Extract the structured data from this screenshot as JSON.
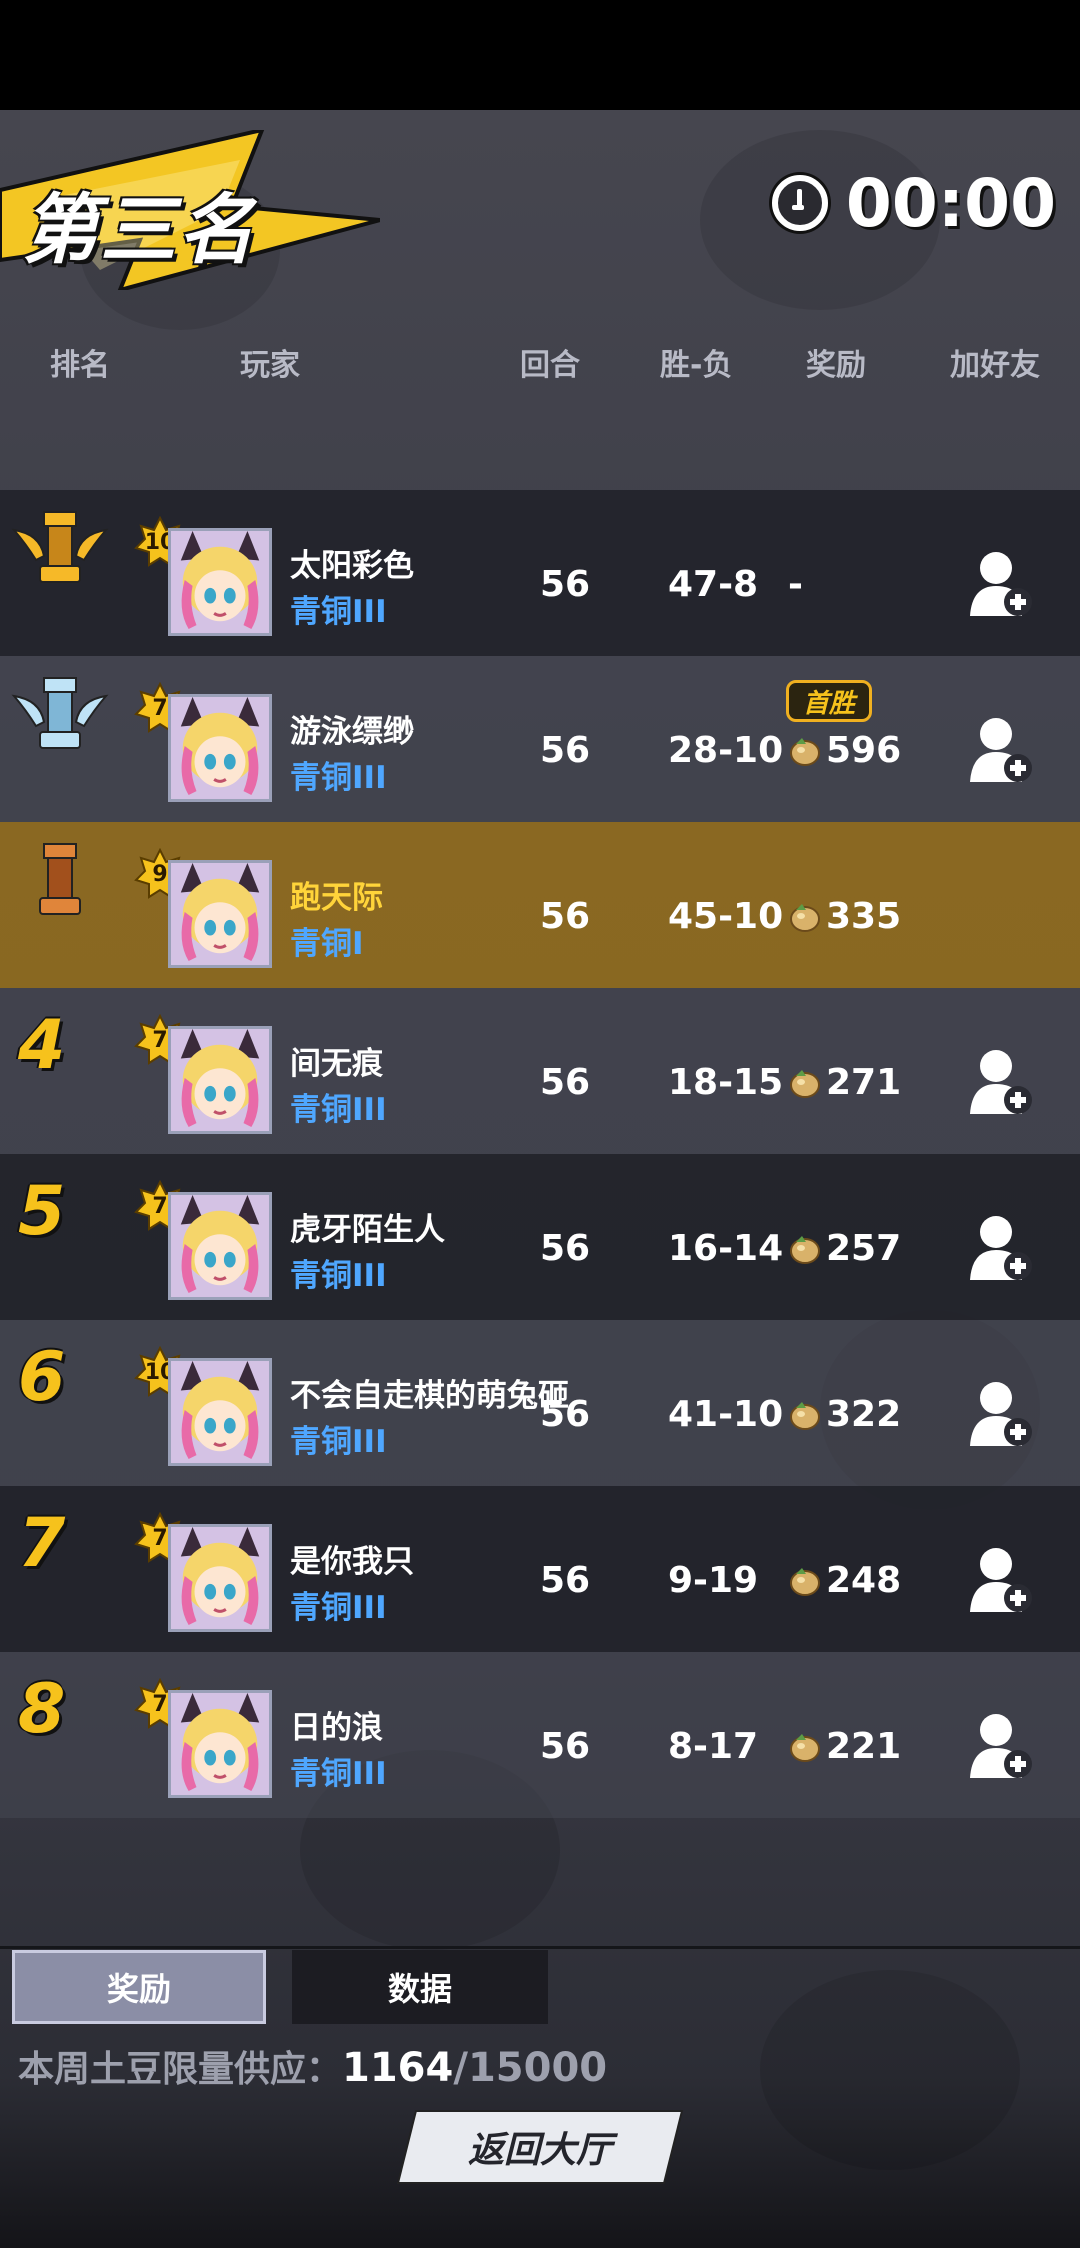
{
  "timer": {
    "value": "00:00"
  },
  "banner": {
    "title": "第三名"
  },
  "header": {
    "rank": "排名",
    "player": "玩家",
    "rounds": "回合",
    "winloss": "胜-负",
    "reward": "奖励",
    "add_friend": "加好友"
  },
  "rows": [
    {
      "rank": "",
      "trophy": "gold",
      "level": "10",
      "name": "太阳彩色",
      "tier": "青铜III",
      "rounds": "56",
      "wl": "47-8",
      "reward": "-",
      "reward_icon": false,
      "first_win": "",
      "add_friend": true
    },
    {
      "rank": "",
      "trophy": "silver",
      "level": "7",
      "name": "游泳缥缈",
      "tier": "青铜III",
      "rounds": "56",
      "wl": "28-10",
      "reward": "596",
      "reward_icon": true,
      "first_win": "首胜",
      "add_friend": true
    },
    {
      "rank": "",
      "trophy": "bronze",
      "level": "9",
      "name": "跑天际",
      "tier": "青铜I",
      "rounds": "56",
      "wl": "45-10",
      "reward": "335",
      "reward_icon": true,
      "first_win": "",
      "add_friend": false
    },
    {
      "rank": "4",
      "trophy": "",
      "level": "7",
      "name": "间无痕",
      "tier": "青铜III",
      "rounds": "56",
      "wl": "18-15",
      "reward": "271",
      "reward_icon": true,
      "first_win": "",
      "add_friend": true
    },
    {
      "rank": "5",
      "trophy": "",
      "level": "7",
      "name": "虎牙陌生人",
      "tier": "青铜III",
      "rounds": "56",
      "wl": "16-14",
      "reward": "257",
      "reward_icon": true,
      "first_win": "",
      "add_friend": true
    },
    {
      "rank": "6",
      "trophy": "",
      "level": "10",
      "name": "不会自走棋的萌兔砸",
      "tier": "青铜III",
      "rounds": "56",
      "wl": "41-10",
      "reward": "322",
      "reward_icon": true,
      "first_win": "",
      "add_friend": true
    },
    {
      "rank": "7",
      "trophy": "",
      "level": "7",
      "name": "是你我只",
      "tier": "青铜III",
      "rounds": "56",
      "wl": "9-19",
      "reward": "248",
      "reward_icon": true,
      "first_win": "",
      "add_friend": true
    },
    {
      "rank": "8",
      "trophy": "",
      "level": "7",
      "name": "日的浪",
      "tier": "青铜III",
      "rounds": "56",
      "wl": "8-17",
      "reward": "221",
      "reward_icon": true,
      "first_win": "",
      "add_friend": true
    }
  ],
  "tabs": {
    "reward": "奖励",
    "data": "数据"
  },
  "supply": {
    "label": "本周土豆限量供应：",
    "current": "1164",
    "max": "/15000"
  },
  "back_button": "返回大厅",
  "colors": {
    "gold": "#f6c21c",
    "tier_blue": "#4fa7ff",
    "highlight_row": "#a87814"
  }
}
